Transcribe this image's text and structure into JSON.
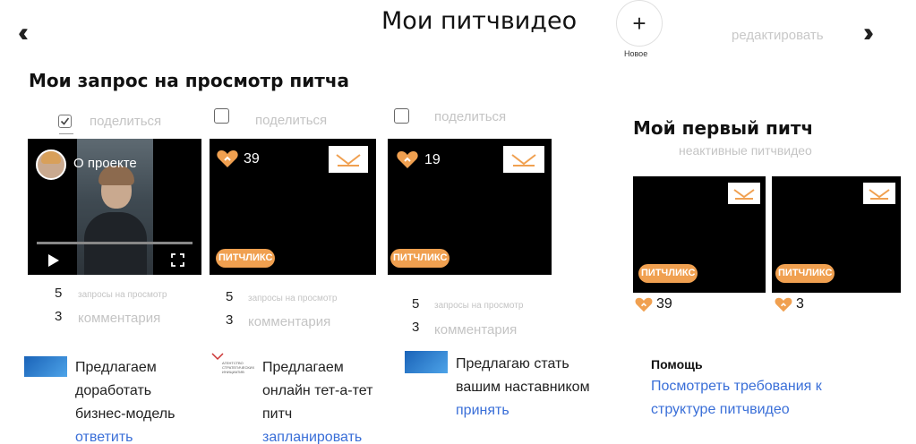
{
  "header": {
    "back_icon": "double-chevron-left",
    "title": "Мои питчвидео",
    "new_label": "Новое",
    "edit_label": "редактировать",
    "forward_icon": "double-chevron-right"
  },
  "requests_section": {
    "heading": "Мои запрос на просмотр питча",
    "items": [
      {
        "checked": true,
        "share_label": "поделиться",
        "video_caption": "О проекте",
        "requests_count": "5",
        "requests_label": "запросы на просмотр",
        "comments_count": "3",
        "comments_label": "комментария",
        "message": "Предлагаем доработать бизнес-модель",
        "action": "ответить"
      },
      {
        "checked": false,
        "share_label": "поделиться",
        "likes": "39",
        "badge": "ПИТЧЛИКС",
        "requests_count": "5",
        "requests_label": "запросы на просмотр",
        "comments_count": "3",
        "comments_label": "комментария",
        "logo_text": "АГЕНТСТВО СТРАТЕГИЧЕСКИХ ИНИЦИАТИВ",
        "message": "Предлагаем онлайн тет-а-тет питч",
        "action": "запланировать"
      },
      {
        "checked": false,
        "share_label": "поделиться",
        "likes": "19",
        "badge": "ПИТЧЛИКС",
        "requests_count": "5",
        "requests_label": "запросы на просмотр",
        "comments_count": "3",
        "comments_label": "комментария",
        "message": "Предлагаю стать вашим наставником",
        "action": "принять"
      }
    ]
  },
  "first_pitch": {
    "heading": "Мой первый питч",
    "inactive_label": "неактивные питчвидео",
    "videos": [
      {
        "badge": "ПИТЧЛИКС",
        "likes": "39"
      },
      {
        "badge": "ПИТЧЛИКС",
        "likes": "3"
      }
    ]
  },
  "help": {
    "title": "Помощь",
    "link_text": "Посмотреть требования к структуре питчвидео"
  },
  "colors": {
    "accent_orange": "#f0a050",
    "link_blue": "#3a6fd8",
    "muted_gray": "#c4c4c4"
  }
}
